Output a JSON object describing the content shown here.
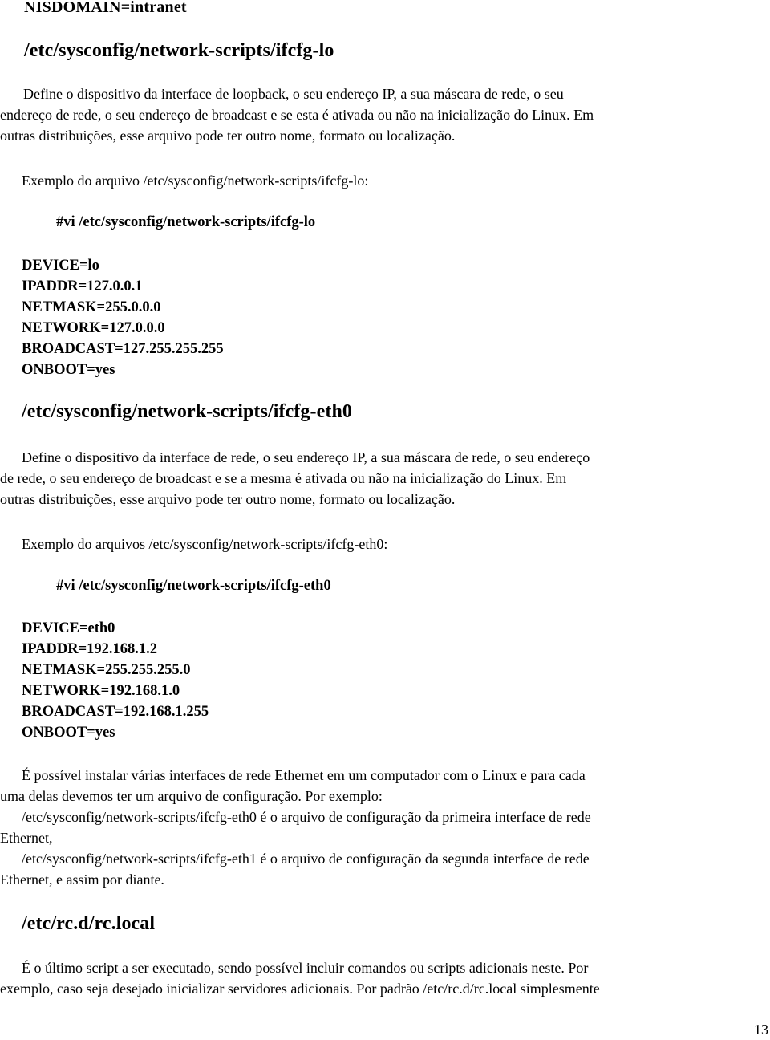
{
  "page": {
    "nisdomain_line": "NISDOMAIN=intranet",
    "page_number": "13"
  },
  "sections": {
    "lo": {
      "heading": "/etc/sysconfig/network-scripts/ifcfg-lo",
      "description_lines": [
        "Define o dispositivo da interface de loopback, o seu endereço IP, a sua máscara de rede, o seu",
        "endereço de rede, o seu endereço de broadcast e se esta é ativada ou não na inicialização do Linux. Em",
        "outras distribuições, esse arquivo pode ter outro nome, formato ou localização."
      ],
      "example_intro": "Exemplo do arquivo /etc/sysconfig/network-scripts/ifcfg-lo:",
      "command": "#vi  /etc/sysconfig/network-scripts/ifcfg-lo",
      "config_lines": [
        "DEVICE=lo",
        "IPADDR=127.0.0.1",
        "NETMASK=255.0.0.0",
        "NETWORK=127.0.0.0",
        "BROADCAST=127.255.255.255",
        "ONBOOT=yes"
      ]
    },
    "eth0": {
      "heading": "/etc/sysconfig/network-scripts/ifcfg-eth0",
      "description_lines": [
        "Define o dispositivo da interface de rede, o seu endereço IP, a sua máscara de rede, o seu endereço",
        "de rede, o seu endereço de broadcast e se a mesma é ativada ou não na inicialização do Linux. Em",
        "outras distribuições, esse arquivo pode ter outro nome, formato ou localização."
      ],
      "example_intro": "Exemplo do arquivos /etc/sysconfig/network-scripts/ifcfg-eth0:",
      "command": "#vi /etc/sysconfig/network-scripts/ifcfg-eth0",
      "config_lines": [
        "DEVICE=eth0",
        "IPADDR=192.168.1.2",
        "NETMASK=255.255.255.0",
        "NETWORK=192.168.1.0",
        "BROADCAST=192.168.1.255",
        "ONBOOT=yes"
      ]
    },
    "multiple": {
      "lines": [
        "É possível instalar várias interfaces de rede Ethernet em um computador com o Linux e para cada",
        "uma delas devemos ter um arquivo de configuração. Por exemplo:",
        "/etc/sysconfig/network-scripts/ifcfg-eth0 é o arquivo de configuração da primeira interface de rede",
        "Ethernet,",
        "/etc/sysconfig/network-scripts/ifcfg-eth1 é o arquivo de configuração da segunda interface de rede",
        "Ethernet, e assim por diante."
      ]
    },
    "rclocal": {
      "heading": "/etc/rc.d/rc.local",
      "lines": [
        "É o último script a ser executado, sendo possível incluir comandos ou scripts adicionais neste. Por",
        "exemplo, caso seja desejado inicializar servidores adicionais. Por padrão /etc/rc.d/rc.local simplesmente"
      ]
    }
  }
}
